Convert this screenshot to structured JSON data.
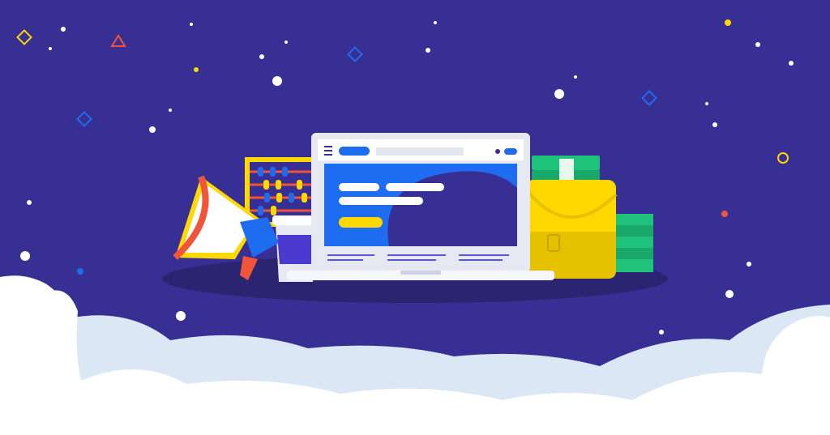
{
  "palette": {
    "background": "#372f93",
    "shadow": "#2b2470",
    "cloud_white": "#ffffff",
    "cloud_shade": "#dce7f5",
    "accent_yellow": "#ffd800",
    "accent_blue": "#1e6cf0",
    "accent_red": "#f0553a",
    "money_green": "#1ec27a",
    "laptop_frame": "#e6e9f2",
    "laptop_screen_dark": "#372f93"
  },
  "icons": [
    "megaphone-icon",
    "abacus-icon",
    "coffee-cup-icon",
    "laptop-icon",
    "briefcase-icon",
    "money-stack-icon",
    "clouds",
    "stars",
    "sparkle-shapes"
  ]
}
